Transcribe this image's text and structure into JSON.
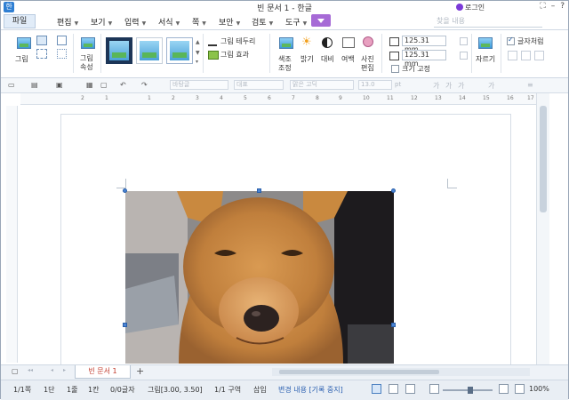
{
  "window": {
    "title": "빈 문서 1 - 한글",
    "controls": [
      "⛶",
      "–",
      "?"
    ]
  },
  "menubar": {
    "file": "파일",
    "items": [
      {
        "label": "편집"
      },
      {
        "label": "보기"
      },
      {
        "label": "입력"
      },
      {
        "label": "서식"
      },
      {
        "label": "쪽"
      },
      {
        "label": "보안"
      },
      {
        "label": "검토"
      },
      {
        "label": "도구"
      }
    ],
    "search_placeholder": "찾을 내용",
    "login": "로그인"
  },
  "ribbon": {
    "picture": "그림",
    "picture_props": [
      "그림",
      "속성"
    ],
    "border": "그림 테두리",
    "effect": "그림 효과",
    "color_adjust": [
      "색조",
      "조정"
    ],
    "brightness": "밝기",
    "contrast": "대비",
    "margin": "여백",
    "photo_edit": [
      "사진",
      "편집"
    ],
    "width": "125.31",
    "height": "125.31",
    "unit": "mm",
    "fix_size": "크기 고정",
    "crop": "자르기",
    "as_char": "글자처럼"
  },
  "toolbar2": {
    "style": "바탕글",
    "outline": "대표",
    "font": "맑은 고딕",
    "size": "13.0",
    "size_unit": "pt"
  },
  "ruler_numbers": [
    "2",
    "1",
    "1",
    "2",
    "3",
    "4",
    "5",
    "6",
    "7",
    "8",
    "9",
    "10",
    "11",
    "12",
    "13",
    "14",
    "15",
    "16",
    "17"
  ],
  "tabs": {
    "doc_tab": "빈 문서 1",
    "add": "+"
  },
  "status": {
    "page": "1/1쪽",
    "section": "1단",
    "line": "1줄",
    "col": "1칸",
    "chars": "0/0글자",
    "object": "그림[3.00, 3.50]",
    "area": "1/1 구역",
    "insert": "삽입",
    "track": "변경 내용 [기록 중지]",
    "zoom": "100%"
  },
  "colors": {
    "accent": "#2f7fd3",
    "context_tab": "#a66ad6",
    "tab_text": "#c0392b"
  }
}
